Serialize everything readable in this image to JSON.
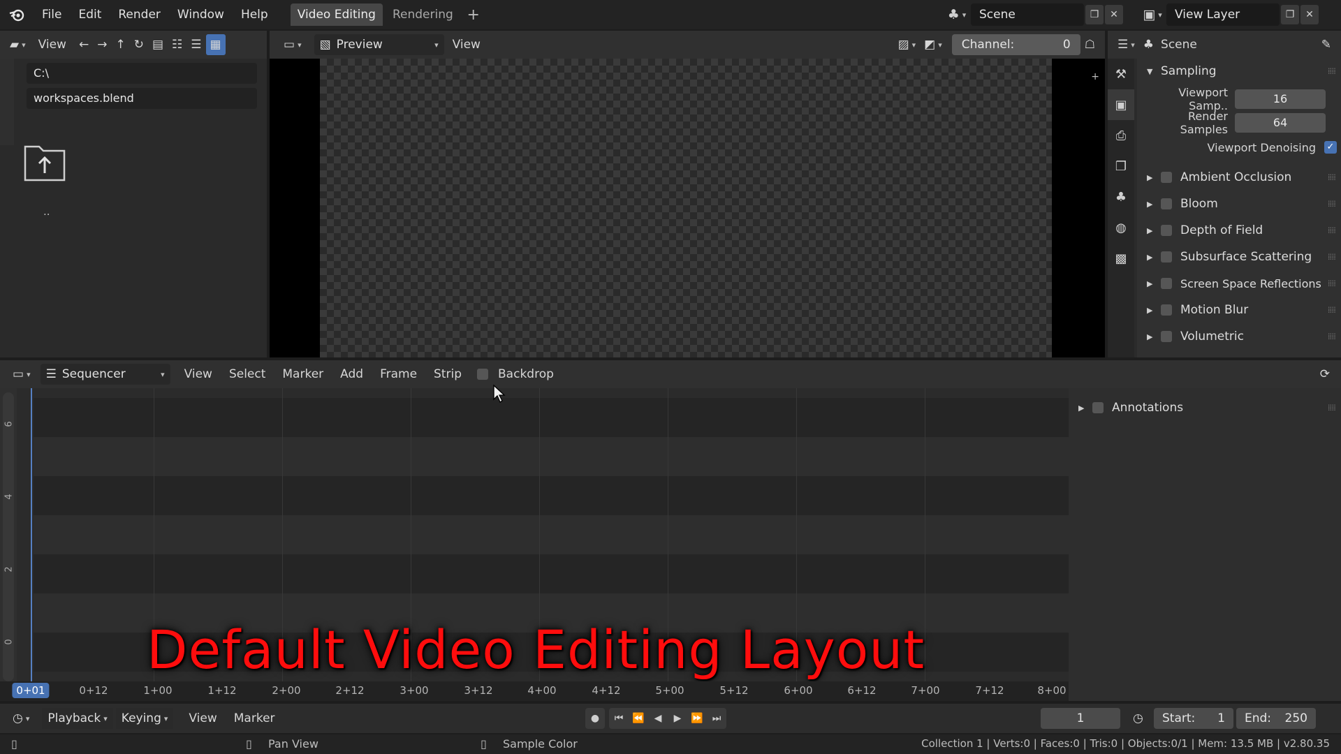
{
  "topbar": {
    "menus": [
      "File",
      "Edit",
      "Render",
      "Window",
      "Help"
    ],
    "workspace_tabs": [
      "Video Editing",
      "Rendering"
    ],
    "scene": "Scene",
    "view_layer": "View Layer"
  },
  "filebrowser": {
    "view_label": "View",
    "path": "C:\\",
    "filename": "workspaces.blend",
    "parent_label": ".."
  },
  "preview": {
    "mode": "Preview",
    "view_label": "View",
    "channel_label": "Channel:",
    "channel_value": "0"
  },
  "properties": {
    "context": "Scene",
    "sampling_label": "Sampling",
    "viewport_samples_label": "Viewport Samp..",
    "viewport_samples": "16",
    "render_samples_label": "Render Samples",
    "render_samples": "64",
    "viewport_denoising_label": "Viewport Denoising",
    "viewport_denoising": true,
    "panels": [
      "Ambient Occlusion",
      "Bloom",
      "Depth of Field",
      "Subsurface Scattering",
      "Screen Space Reflections",
      "Motion Blur",
      "Volumetric"
    ]
  },
  "sequencer": {
    "editor_name": "Sequencer",
    "menus": [
      "View",
      "Select",
      "Marker",
      "Add",
      "Frame",
      "Strip"
    ],
    "backdrop_label": "Backdrop",
    "annotations_label": "Annotations",
    "channel_numbers": [
      "6",
      "4",
      "2",
      "0"
    ],
    "time_marks": [
      "0+01",
      "0+12",
      "1+00",
      "1+12",
      "2+00",
      "2+12",
      "3+00",
      "3+12",
      "4+00",
      "4+12",
      "5+00",
      "5+12",
      "6+00",
      "6+12",
      "7+00",
      "7+12",
      "8+00"
    ],
    "current_time": "0+01",
    "overlay_title": "Default Video Editing Layout"
  },
  "timeline": {
    "playback_label": "Playback",
    "keying_label": "Keying",
    "view_label": "View",
    "marker_label": "Marker",
    "current_frame": "1",
    "start_label": "Start:",
    "start_value": "1",
    "end_label": "End:",
    "end_value": "250"
  },
  "statusbar": {
    "pan_view": "Pan View",
    "sample_color": "Sample Color",
    "stats": "Collection 1 | Verts:0 | Faces:0 | Tris:0 | Objects:0/1 | Mem: 13.5 MB | v2.80.35"
  },
  "colors": {
    "accent": "#4772b3",
    "overlay_text": "#ff0d0d",
    "playhead": "#5680c2"
  }
}
